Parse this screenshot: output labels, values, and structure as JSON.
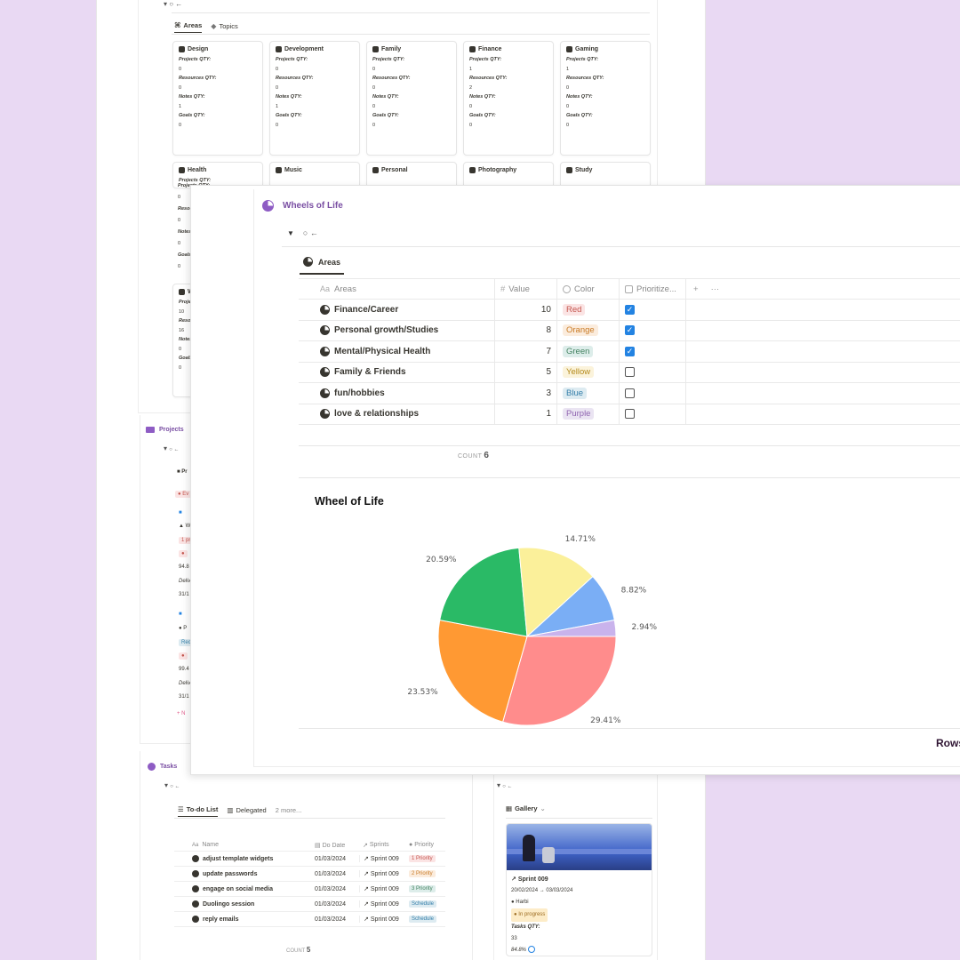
{
  "background": {
    "toggle": "○ ←",
    "tabs": [
      {
        "label": "Areas",
        "active": true
      },
      {
        "label": "Topics",
        "active": false
      }
    ],
    "field_labels": [
      "Projects QTY:",
      "Resources QTY:",
      "Notes QTY:",
      "Goals QTY:"
    ],
    "cards_row1": [
      {
        "name": "Design",
        "values": [
          "0",
          "0",
          "1",
          "0"
        ]
      },
      {
        "name": "Development",
        "values": [
          "0",
          "0",
          "1",
          "0"
        ]
      },
      {
        "name": "Family",
        "values": [
          "0",
          "0",
          "0",
          "0"
        ]
      },
      {
        "name": "Finance",
        "values": [
          "1",
          "2",
          "0",
          "0"
        ]
      },
      {
        "name": "Gaming",
        "values": [
          "1",
          "0",
          "0",
          "0"
        ]
      }
    ],
    "cards_row2": [
      {
        "name": "Health",
        "values": [
          "0",
          "0",
          "0",
          "0"
        ]
      },
      {
        "name": "Music"
      },
      {
        "name": "Personal"
      },
      {
        "name": "Photography"
      },
      {
        "name": "Study"
      }
    ],
    "card_row3_values": [
      "10",
      "16",
      "0",
      "0"
    ],
    "card_row3_fragments": [
      "W",
      "Projec",
      "Resou",
      "Notes",
      "Goals"
    ],
    "projects_title": "Projects",
    "projects_fragments": [
      "Pr",
      "Ev",
      "W",
      "1 pr",
      "94.8",
      "Deliv",
      "31/1",
      "P",
      "Rec",
      "99.4",
      "Deliv",
      "31/1",
      "+ N"
    ],
    "tasks": {
      "title": "Tasks",
      "toggle": "○ ←",
      "tabs": [
        "To-do List",
        "Delegated",
        "2 more..."
      ],
      "columns": [
        "Name",
        "Do Date",
        "Sprints",
        "Priority"
      ],
      "rows": [
        {
          "name": "adjust template widgets",
          "date": "01/03/2024",
          "sprint": "Sprint 009",
          "priority": "1 Priority",
          "pcolor": "#fbe4e4",
          "ptext": "#c4554d"
        },
        {
          "name": "update passwords",
          "date": "01/03/2024",
          "sprint": "Sprint 009",
          "priority": "2 Priority",
          "pcolor": "#fbecdd",
          "ptext": "#c97b26"
        },
        {
          "name": "engage on social media",
          "date": "01/03/2024",
          "sprint": "Sprint 009",
          "priority": "3 Priority",
          "pcolor": "#ddedea",
          "ptext": "#448361"
        },
        {
          "name": "Duolingo session",
          "date": "01/03/2024",
          "sprint": "Sprint 009",
          "priority": "Schedule",
          "pcolor": "#ddebf1",
          "ptext": "#337ea9"
        },
        {
          "name": "reply emails",
          "date": "01/03/2024",
          "sprint": "Sprint 009",
          "priority": "Schedule",
          "pcolor": "#ddebf1",
          "ptext": "#337ea9"
        }
      ],
      "count_label": "COUNT",
      "count_value": "5"
    },
    "gallery": {
      "toggle": "○ ←",
      "tab": "Gallery",
      "card_title": "Sprint 009",
      "dates": "20/02/2024 → 03/03/2024",
      "owner": "Harbi",
      "status": "In progress",
      "tasks_label": "Tasks QTY:",
      "tasks_value": "33",
      "progress": "84.8%"
    }
  },
  "main": {
    "title": "Wheels of Life",
    "toggle": "○ ←",
    "tab": "Areas",
    "columns": {
      "name": "Areas",
      "value": "Value",
      "color": "Color",
      "prioritize": "Prioritize...",
      "add": "+",
      "more": "···"
    },
    "rows": [
      {
        "name": "Finance/Career",
        "value": "10",
        "color": "Red",
        "bg": "#fbe4e4",
        "fg": "#c4554d",
        "checked": true
      },
      {
        "name": "Personal growth/Studies",
        "value": "8",
        "color": "Orange",
        "bg": "#fbecdd",
        "fg": "#c97b26",
        "checked": true
      },
      {
        "name": "Mental/Physical Health",
        "value": "7",
        "color": "Green",
        "bg": "#ddedea",
        "fg": "#448361",
        "checked": true
      },
      {
        "name": "Family & Friends",
        "value": "5",
        "color": "Yellow",
        "bg": "#fbf3db",
        "fg": "#b48a1b",
        "checked": false
      },
      {
        "name": "fun/hobbies",
        "value": "3",
        "color": "Blue",
        "bg": "#ddebf1",
        "fg": "#337ea9",
        "checked": false
      },
      {
        "name": "love & relationships",
        "value": "1",
        "color": "Purple",
        "bg": "#eae4f2",
        "fg": "#9065b0",
        "checked": false
      }
    ],
    "count_label": "COUNT",
    "count_value": "6",
    "rows_label": "Rows"
  },
  "chart_data": {
    "type": "pie",
    "title": "Wheel of Life",
    "categories": [
      "Finance/Career",
      "Personal growth/Studies",
      "Mental/Physical Health",
      "Family & Friends",
      "fun/hobbies",
      "love & relationships"
    ],
    "values": [
      10,
      8,
      7,
      5,
      3,
      1
    ],
    "labels": [
      "29.41%",
      "23.53%",
      "20.59%",
      "14.71%",
      "8.82%",
      "2.94%"
    ],
    "colors": [
      "#ff8c8c",
      "#ff9933",
      "#2aba66",
      "#fbf09a",
      "#7aaef5",
      "#c9b3ec"
    ]
  }
}
